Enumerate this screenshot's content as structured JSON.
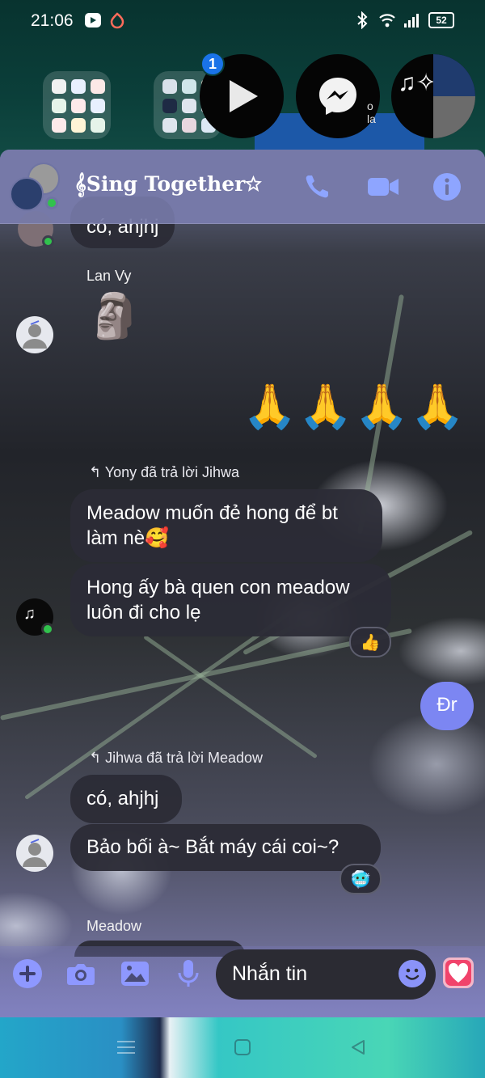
{
  "status_bar": {
    "time": "21:06",
    "battery": "52"
  },
  "home": {
    "bubble_badge": "1",
    "bubble_fragment_text": "o la"
  },
  "chat": {
    "title": "𝄞Sing Together☆",
    "call_icon": "phone-icon",
    "video_icon": "video-camera-icon",
    "info_icon": "info-icon"
  },
  "messages": {
    "top_partial": "có, ahjhj",
    "lanvy_name": "Lan Vy",
    "lanvy_sticker": "🗿",
    "outgoing_emojis": "🙏🙏🙏🙏",
    "reply1_label": "Yony đã trả lời Jihwa",
    "yony_msg1": "Meadow muốn đẻ hong để bt làm nè🥰",
    "yony_msg2": "Hong ấy bà quen con meadow luôn đi cho lẹ",
    "yony_reaction": "👍",
    "outgoing_dr": "Đr",
    "reply2_label": "Jihwa đã trả lời Meadow",
    "jihwa_msg1": "có, ahjhj",
    "jihwa_msg2": "Bảo bối à~ Bắt máy cái coi~?",
    "jihwa_reaction": "🥶",
    "meadow_name": "Meadow"
  },
  "composer": {
    "placeholder": "Nhắn tin",
    "plus_icon": "plus-circle-icon",
    "camera_icon": "camera-icon",
    "gallery_icon": "image-icon",
    "mic_icon": "microphone-icon",
    "emoji_icon": "smiley-icon",
    "heart_icon": "heart-icon"
  },
  "colors": {
    "accent": "#7c86f2",
    "header_bg": "#767aa8",
    "bubble_in": "#2c2c36",
    "online": "#31c24d"
  }
}
